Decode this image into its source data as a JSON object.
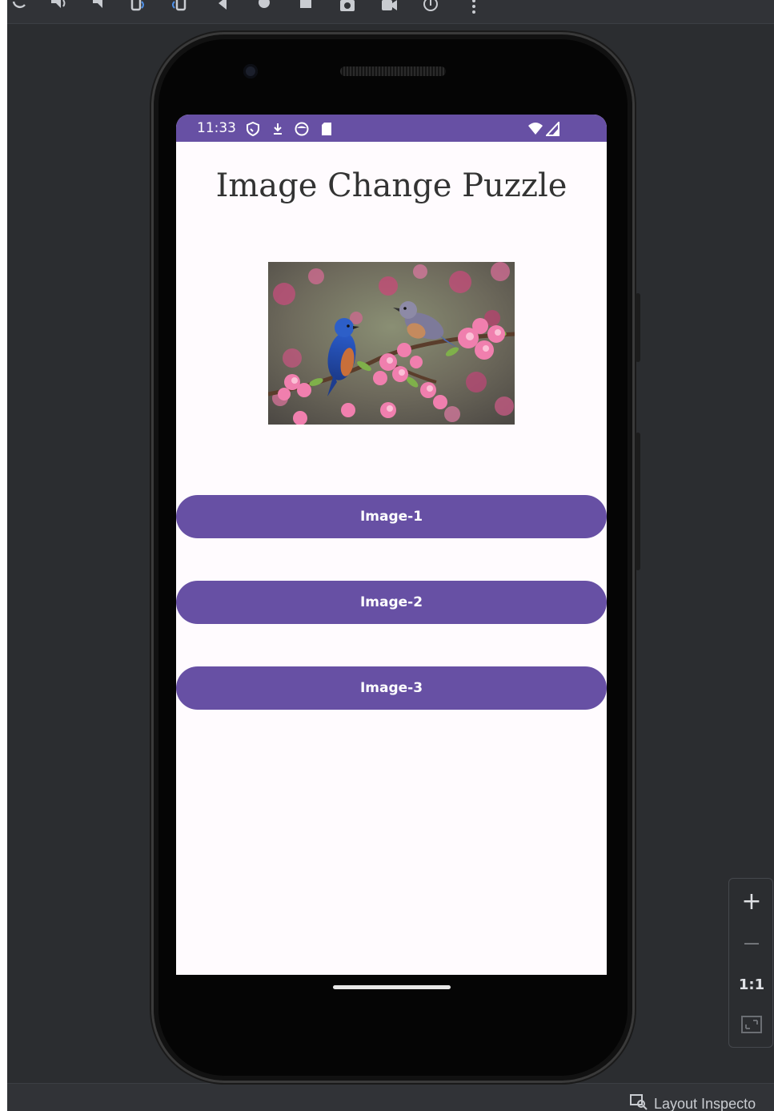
{
  "app": {
    "title": "Image Change Puzzle",
    "buttons": [
      {
        "label": "Image-1"
      },
      {
        "label": "Image-2"
      },
      {
        "label": "Image-3"
      }
    ],
    "image": {
      "subject": "two bluebirds on pink blossom branch"
    }
  },
  "status_bar": {
    "time": "11:33",
    "icons": [
      "shield-icon",
      "download-icon",
      "face-icon",
      "sd-card-icon",
      "wifi-icon",
      "signal-icon"
    ],
    "color": "#6750a4"
  },
  "emulator": {
    "zoom_controls": {
      "zoom_in": "+",
      "zoom_out": "—",
      "actual_size": "1:1"
    },
    "bottom_bar": {
      "layout_inspector": "Layout Inspecto"
    }
  },
  "colors": {
    "accent": "#6750a4",
    "screen_bg": "#fffbfe",
    "panel_bg": "#2b2d30"
  }
}
